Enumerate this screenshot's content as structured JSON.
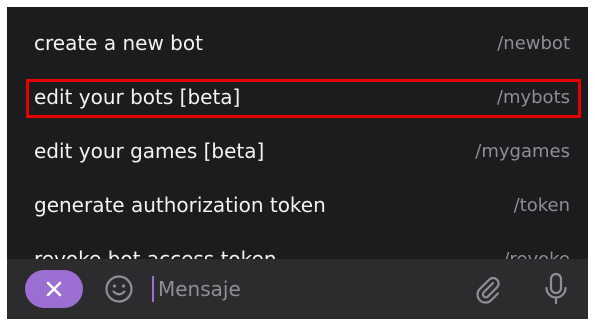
{
  "commands": [
    {
      "description": "create a new bot",
      "command": "/newbot"
    },
    {
      "description": "edit your bots [beta]",
      "command": "/mybots"
    },
    {
      "description": "edit your games [beta]",
      "command": "/mygames"
    },
    {
      "description": "generate authorization token",
      "command": "/token"
    },
    {
      "description": "revoke bot access token",
      "command": "/revoke"
    }
  ],
  "composer": {
    "placeholder": "Mensaje",
    "close_icon": "close-icon",
    "emoji_icon": "smiley-icon",
    "attach_icon": "paperclip-icon",
    "mic_icon": "microphone-icon"
  },
  "colors": {
    "background": "#1c1c1e",
    "composer_background": "#2c2c2e",
    "accent": "#9b6fd1",
    "highlight": "#e60000"
  }
}
